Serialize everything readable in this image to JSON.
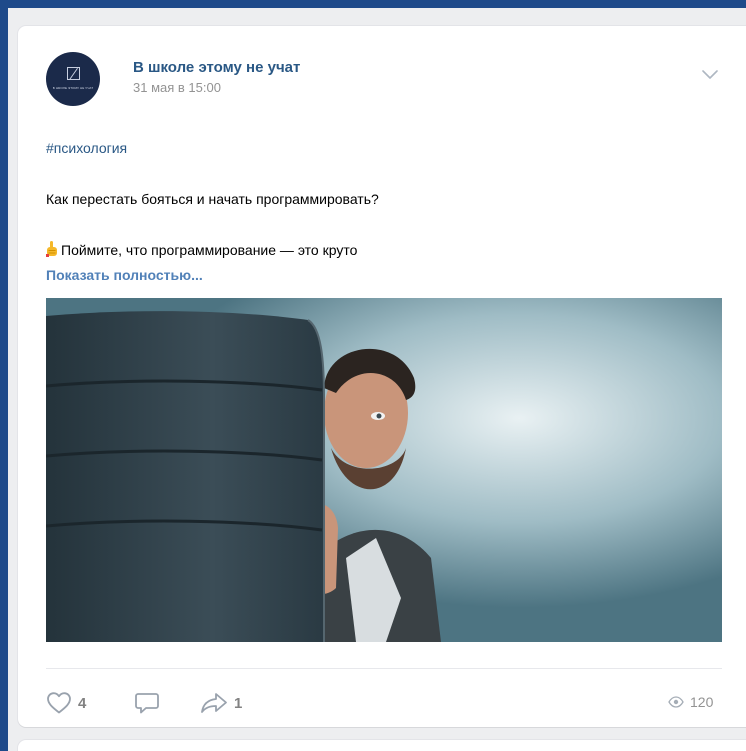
{
  "post": {
    "author": "В школе этому не учат",
    "date": "31 мая в 15:00",
    "hashtag": "#психология",
    "text_line1": "Как перестать бояться и начать программировать?",
    "text_line2": "Поймите, что программирование — это круто",
    "show_more": "Показать полностью...",
    "avatar_caption": "В ШКОЛЕ ЭТОМУ НЕ УЧАТ",
    "likes": "4",
    "shares": "1",
    "views": "120",
    "icons": {
      "like": "heart-icon",
      "comment": "comment-icon",
      "share": "share-icon",
      "views": "eye-icon",
      "menu": "chevron-down-icon",
      "emoji": "pointing-up-emoji"
    }
  },
  "colors": {
    "link": "#2a5885",
    "accent": "#5181b8",
    "muted": "#939393",
    "background": "#edeef0",
    "outer": "#1e4a8a"
  }
}
